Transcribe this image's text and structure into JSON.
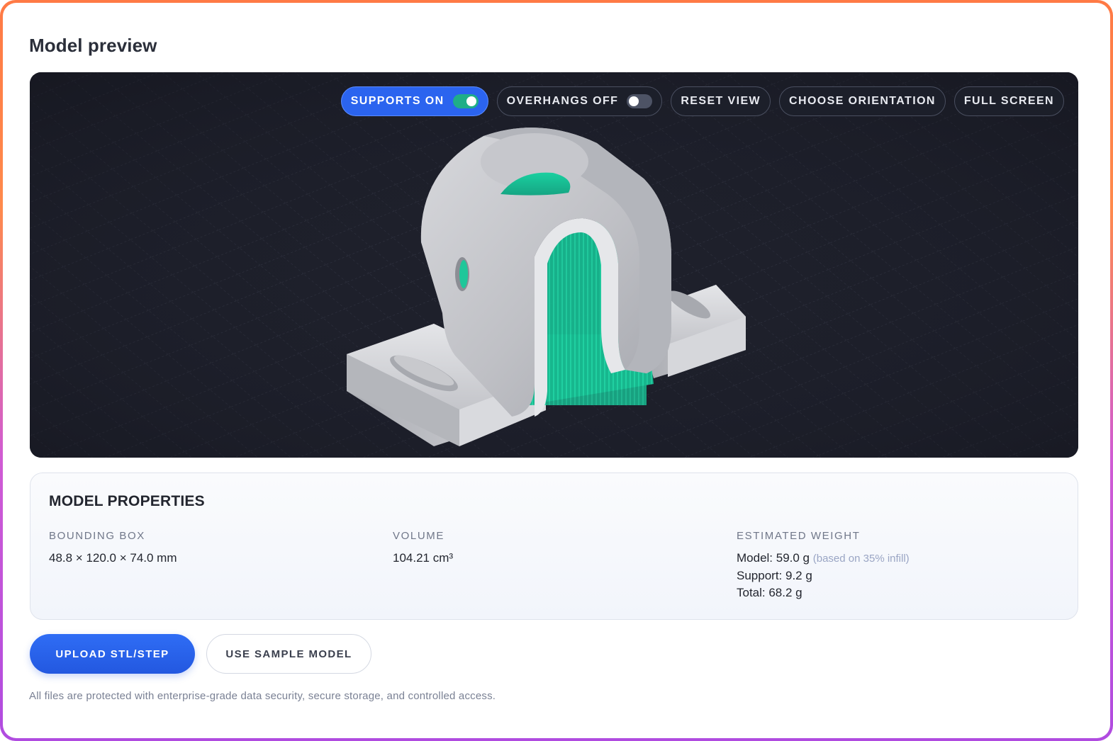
{
  "page": {
    "title": "Model preview"
  },
  "viewer": {
    "toolbar": {
      "supports": {
        "label": "SUPPORTS ON",
        "state": "on"
      },
      "overhangs": {
        "label": "OVERHANGS OFF",
        "state": "off"
      },
      "reset_view": "RESET VIEW",
      "choose_orientation": "CHOOSE ORIENTATION",
      "full_screen": "FULL SCREEN"
    },
    "colors": {
      "background": "#1d1f2a",
      "model": "#cfd0d4",
      "support": "#1fbf93",
      "toggle_on": "#1fae88",
      "active_button": "#2b64ef"
    }
  },
  "properties": {
    "title": "MODEL PROPERTIES",
    "bounding_box": {
      "label": "BOUNDING BOX",
      "value": "48.8 × 120.0 × 74.0 mm"
    },
    "volume": {
      "label": "VOLUME",
      "value": "104.21 cm³"
    },
    "weight": {
      "label": "ESTIMATED WEIGHT",
      "model": "Model: 59.0 g",
      "model_note": "(based on 35% infill)",
      "support": "Support: 9.2 g",
      "total": "Total: 68.2 g"
    }
  },
  "actions": {
    "upload": "UPLOAD STL/STEP",
    "sample": "USE SAMPLE MODEL"
  },
  "footnote": "All files are protected with enterprise-grade data security, secure storage, and controlled access."
}
